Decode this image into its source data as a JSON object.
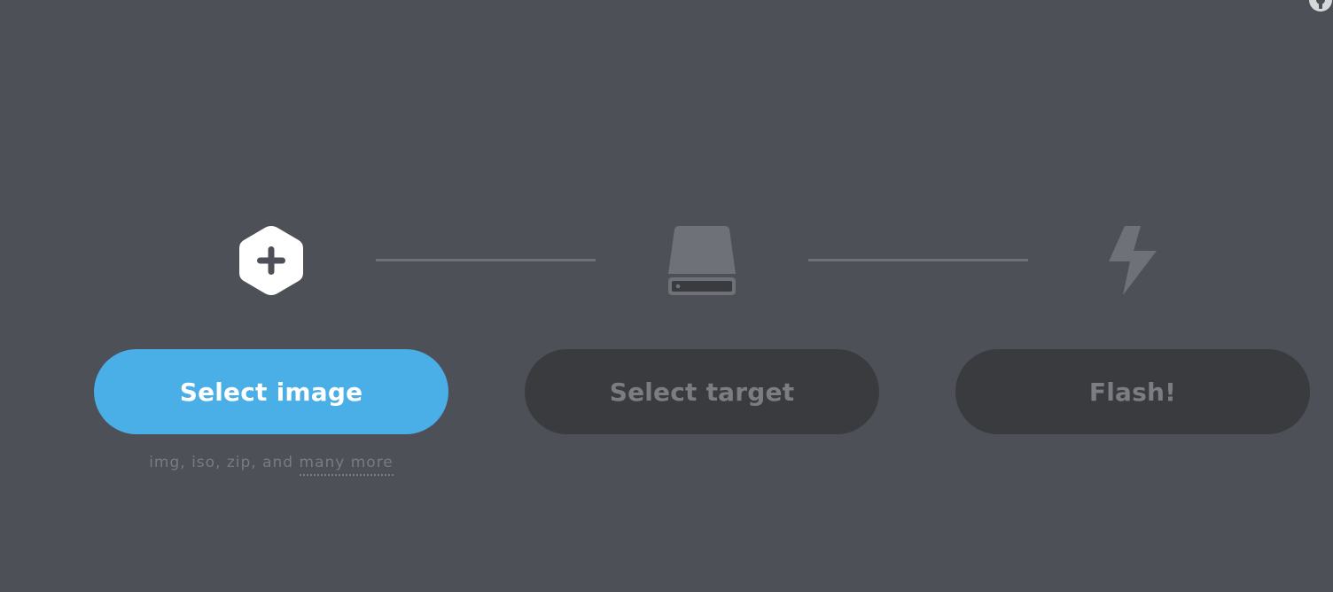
{
  "colors": {
    "background": "#4d5057",
    "accent": "#4aaee7",
    "disabled_button": "#3a3b3f",
    "disabled_text": "#7b7d82",
    "connector": "#6e7177"
  },
  "corner": {
    "icon": "settings-icon"
  },
  "steps": {
    "image": {
      "icon": "plus-hexagon-icon",
      "button_label": "Select image",
      "hint_text": "img, iso, zip, and ",
      "hint_link": "many more"
    },
    "target": {
      "icon": "drive-icon",
      "button_label": "Select target"
    },
    "flash": {
      "icon": "lightning-icon",
      "button_label": "Flash!"
    }
  }
}
